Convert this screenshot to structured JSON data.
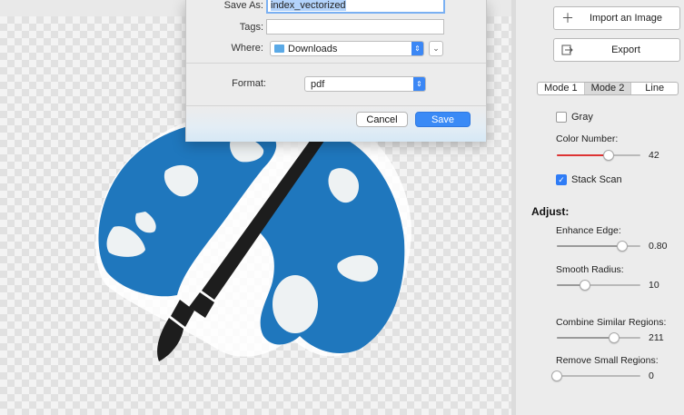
{
  "dialog": {
    "save_as_label": "Save As:",
    "save_as_value": "index_vectorized",
    "tags_label": "Tags:",
    "tags_value": "",
    "where_label": "Where:",
    "where_value": "Downloads",
    "format_label": "Format:",
    "format_value": "pdf",
    "cancel_label": "Cancel",
    "save_label": "Save"
  },
  "panel": {
    "import_label": "Import an Image",
    "export_label": "Export",
    "modes": [
      "Mode 1",
      "Mode 2",
      "Line"
    ],
    "active_mode": "Mode 2",
    "gray_label": "Gray",
    "gray_checked": false,
    "color_number_label": "Color Number:",
    "color_number_value": "42",
    "color_number_fraction": 0.62,
    "stack_scan_label": "Stack Scan",
    "stack_scan_checked": true,
    "adjust_heading": "Adjust:",
    "enhance_edge_label": "Enhance Edge:",
    "enhance_edge_value": "0.80",
    "enhance_edge_fraction": 0.78,
    "smooth_radius_label": "Smooth Radius:",
    "smooth_radius_value": "10",
    "smooth_radius_fraction": 0.34,
    "combine_label": "Combine Similar Regions:",
    "combine_value": "211",
    "combine_fraction": 0.68,
    "remove_label": "Remove Small Regions:",
    "remove_value": "0",
    "remove_fraction": 0.0
  },
  "colors": {
    "palette_blue": "#1f77bd",
    "brush_dark": "#1d1d1d",
    "accent": "#3a8af6"
  },
  "canvas": {
    "image_icon": "paint-palette-icon"
  }
}
